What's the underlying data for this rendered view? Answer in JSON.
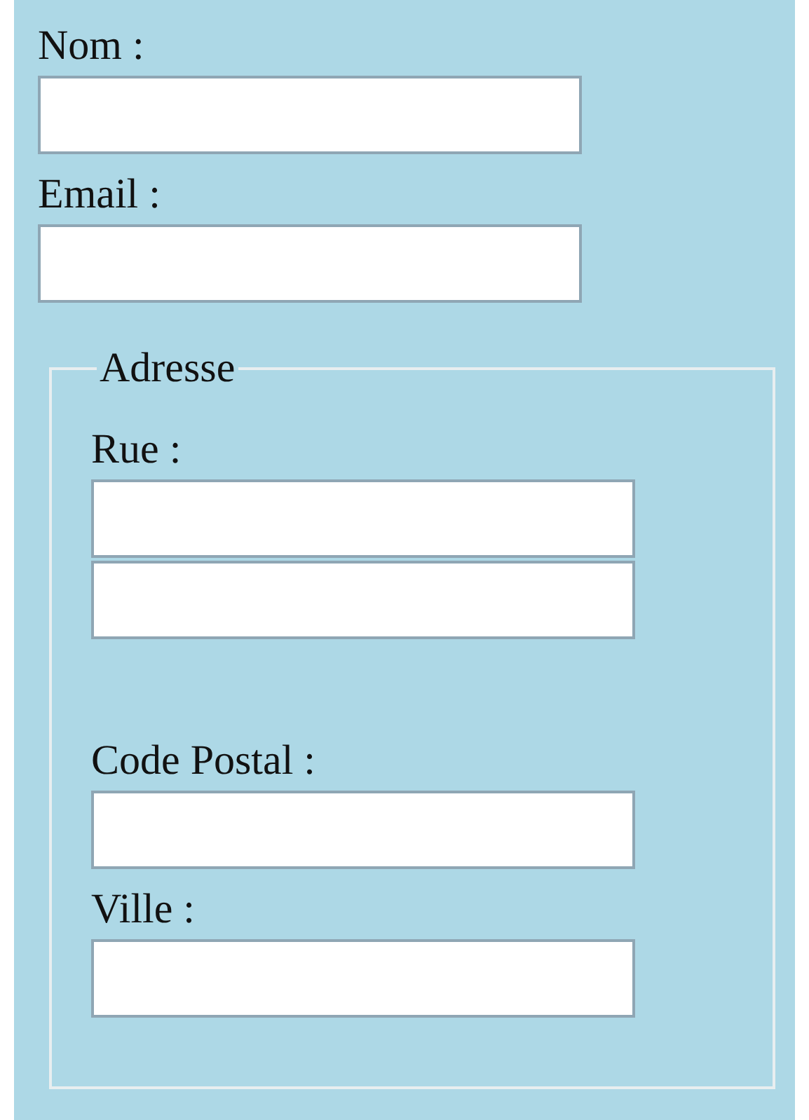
{
  "fields": [
    {
      "label": "Nom :",
      "kind": "single"
    },
    {
      "label": "Email :",
      "kind": "single"
    }
  ],
  "fieldset": {
    "legend": "Adresse",
    "fields": [
      {
        "label": "Rue :",
        "kind": "two-line"
      },
      {
        "label": "Code Postal :",
        "kind": "single"
      },
      {
        "label": "Ville :",
        "kind": "single"
      }
    ]
  }
}
